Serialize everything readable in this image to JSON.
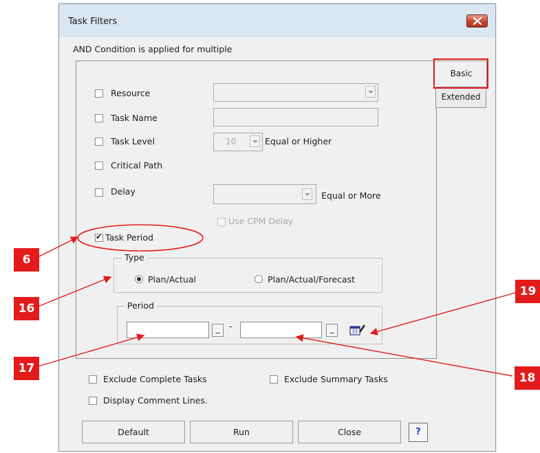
{
  "dialog": {
    "title": "Task Filters",
    "condition_note": "AND Condition is applied for multiple"
  },
  "tabs": [
    {
      "label": "Basic",
      "active": true
    },
    {
      "label": "Extended",
      "active": false
    }
  ],
  "filters": {
    "resource": {
      "label": "Resource",
      "checked": false
    },
    "task_name": {
      "label": "Task Name",
      "checked": false
    },
    "task_level": {
      "label": "Task Level",
      "checked": false,
      "value": "10",
      "suffix": "Equal or Higher"
    },
    "critical_path": {
      "label": "Critical Path",
      "checked": false
    },
    "delay": {
      "label": "Delay",
      "checked": false,
      "suffix": "Equal or More"
    },
    "use_cpm_delay": {
      "label": "Use CPM Delay",
      "checked": false,
      "enabled": false
    },
    "task_period": {
      "label": "Task Period",
      "checked": true,
      "check_glyph": "✔"
    }
  },
  "type_group": {
    "legend": "Type",
    "options": [
      {
        "label": "Plan/Actual",
        "selected": true
      },
      {
        "label": "Plan/Actual/Forecast",
        "selected": false
      }
    ]
  },
  "period_group": {
    "legend": "Period",
    "start_value": "",
    "end_value": "",
    "picker_glyph": "_",
    "separator": "-",
    "calendar_icon": "calendar-edit-icon"
  },
  "options": {
    "exclude_complete": {
      "label": "Exclude Complete Tasks",
      "checked": false
    },
    "exclude_summary": {
      "label": "Exclude Summary Tasks",
      "checked": false
    },
    "display_comment": {
      "label": "Display Comment Lines.",
      "checked": false
    }
  },
  "buttons": {
    "default": "Default",
    "run": "Run",
    "close": "Close",
    "help": "?"
  },
  "callouts": {
    "badge_6": "6",
    "badge_16": "16",
    "badge_17": "17",
    "badge_18": "18",
    "badge_19": "19"
  },
  "colors": {
    "callout_red": "#e31b1b",
    "title_bar": "#dbe6f3",
    "dialog_bg": "#f0f0f0",
    "help_blue": "#1f3fd1"
  }
}
